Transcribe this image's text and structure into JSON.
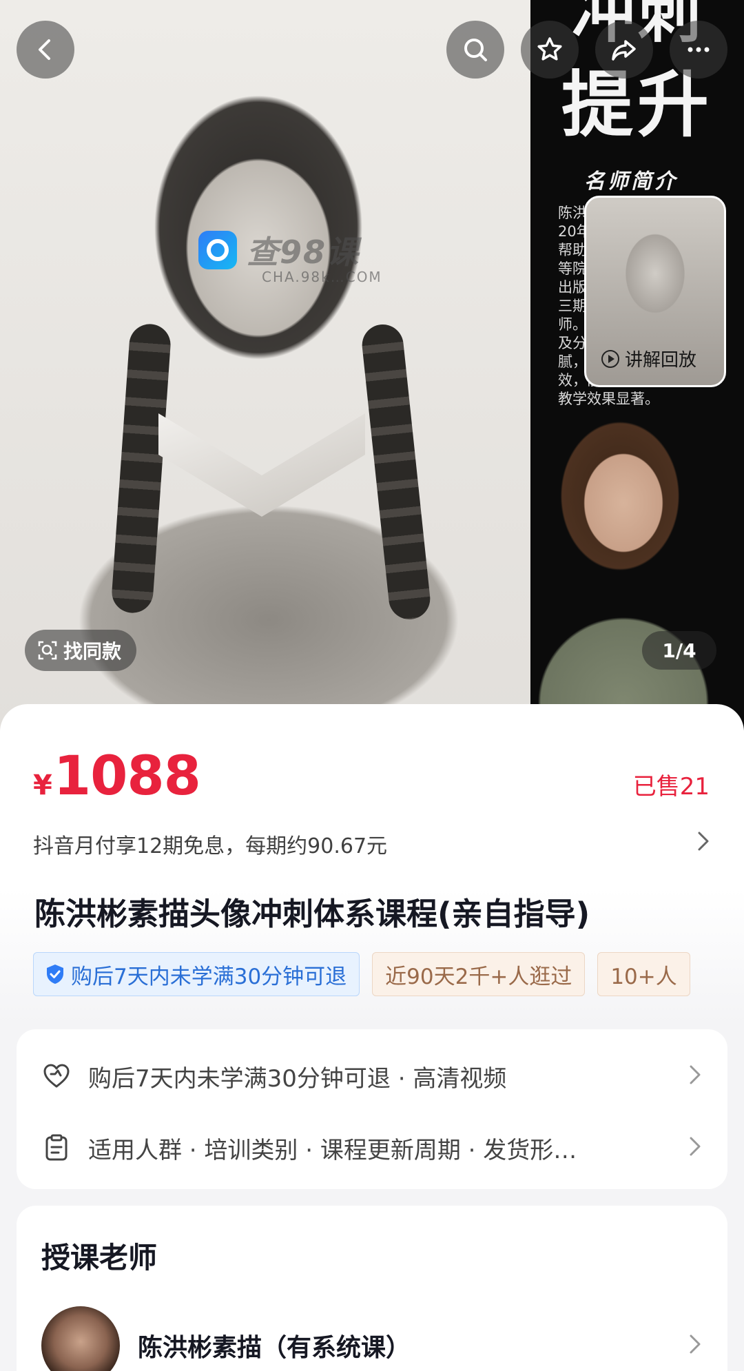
{
  "hero": {
    "side_top_text": "冲刺",
    "side_big_text": "提升",
    "side_subtitle": "名师简介",
    "side_paragraph": "陈洪彬\n20年\n帮助\n等院\n出版\n三期\n师。\n及分\n腻，教学\n效，能快速提高\n教学效果显著。",
    "mini_video_label": "讲解回放",
    "watermark_text": "查98课",
    "watermark_url": "CHA.98k…COM",
    "find_same_label": "找同款",
    "page_indicator": "1/4"
  },
  "price": {
    "currency": "¥",
    "amount": "1088",
    "sold": "已售21",
    "installment": "抖音月付享12期免息，每期约90.67元"
  },
  "product": {
    "title": "陈洪彬素描头像冲刺体系课程(亲自指导)",
    "tags": [
      "购后7天内未学满30分钟可退",
      "近90天2千+人逛过",
      "10+人"
    ]
  },
  "info": {
    "rows": [
      "购后7天内未学满30分钟可退 · 高清视频",
      "适用人群 · 培训类别 · 课程更新周期 · 发货形…"
    ]
  },
  "teacher": {
    "heading": "授课老师",
    "name": "陈洪彬素描（有系统课）"
  },
  "colors": {
    "price_red": "#e8223d",
    "tag_blue": "#2a6fd6",
    "tag_tan": "#9a6a4a"
  },
  "icons": [
    "back-icon",
    "search-icon",
    "star-icon",
    "share-icon",
    "more-icon",
    "scan-icon",
    "play-icon",
    "shield-icon",
    "heart-icon",
    "clipboard-icon",
    "chevron-right-icon"
  ]
}
